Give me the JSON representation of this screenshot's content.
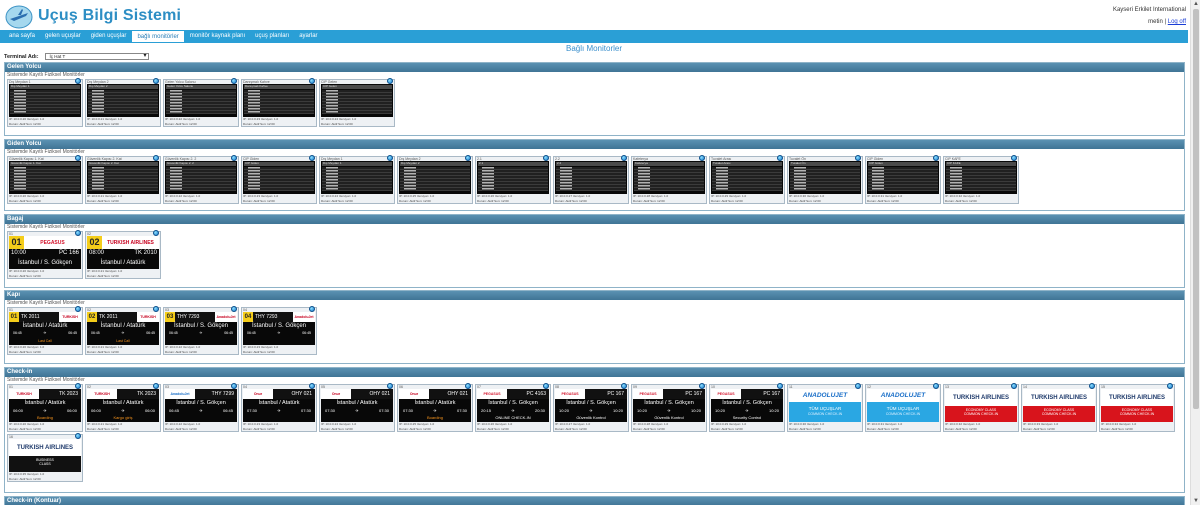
{
  "app": {
    "title": "Uçuş Bilgi Sistemi"
  },
  "user": {
    "airport": "Kayseri Erkilet International",
    "name": "metin",
    "separator": "|",
    "logout": "Log off"
  },
  "nav": [
    {
      "label": "ana sayfa",
      "active": false
    },
    {
      "label": "gelen uçuşlar",
      "active": false
    },
    {
      "label": "giden uçuşlar",
      "active": false
    },
    {
      "label": "bağlı monitörler",
      "active": true
    },
    {
      "label": "monitör kaynak planı",
      "active": false
    },
    {
      "label": "uçuş planları",
      "active": false
    },
    {
      "label": "ayarlar",
      "active": false
    }
  ],
  "page": {
    "heading": "Bağlı Monitorler",
    "terminal_label": "Terminal Adı:",
    "terminal_value": "İç Hat T"
  },
  "sections": [
    {
      "id": "gelen",
      "title": "Gelen Yolcu",
      "subtitle": "Sistemde Kayıtlı Fiziksel Monitörler",
      "kind": "list",
      "monitors": [
        "Dış Meydan 1",
        "Dış Meydan 2",
        "Gelen Yolcu Salonu",
        "Danışmalı Kahve",
        "CIP Gelen"
      ]
    },
    {
      "id": "giden",
      "title": "Giden Yolcu",
      "subtitle": "Sistemde Kayıtlı Fiziksel Monitörler",
      "kind": "list",
      "monitors": [
        "Güvenlik Kapısı 1. Kat",
        "Güvenlik Kapısı 2. Kat",
        "Güvenlik Kapısı 2. 2",
        "CIP Giden",
        "Dış Meydan 1",
        "Dış Meydan 2",
        "2.1",
        "2.2",
        "Kafeterya",
        "Tuvalet Arası",
        "Tuvalet Ön",
        "CIP Giden",
        "CIP KAFE"
      ]
    },
    {
      "id": "bagaj",
      "title": "Bagaj",
      "subtitle": "Sistemde Kayıtlı Fiziksel Monitörler",
      "kind": "baggage",
      "monitors": [
        {
          "num": "01",
          "brand": "PEGASUS",
          "brand_color": "#d4122a",
          "time": "10:00",
          "flight": "PC 166",
          "dest": "İstanbul / S. Gökçen"
        },
        {
          "num": "02",
          "brand": "TURKISH AIRLINES",
          "brand_color": "#c7001e",
          "time": "08:00",
          "flight": "TK 2010",
          "dest": "İstanbul / Atatürk"
        }
      ]
    },
    {
      "id": "kapi",
      "title": "Kapı",
      "subtitle": "Sistemde Kayıtlı Fiziksel Monitörler",
      "kind": "gate",
      "monitors": [
        {
          "num": "01",
          "flight": "TK 2011",
          "logo": "TURKISH",
          "dest": "İstanbul / Atatürk",
          "t1": "06:45",
          "t2": "06:45",
          "status": "Last Call"
        },
        {
          "num": "02",
          "flight": "TK 2011",
          "logo": "TURKISH",
          "dest": "İstanbul / Atatürk",
          "t1": "06:45",
          "t2": "06:45",
          "status": "Last Call"
        },
        {
          "num": "03",
          "flight": "THY 7293",
          "logo": "AnadoluJet",
          "dest": "İstanbul / S. Gökçen",
          "t1": "06:45",
          "t2": "06:45",
          "status": ""
        },
        {
          "num": "04",
          "flight": "THY 7293",
          "logo": "AnadoluJet",
          "dest": "İstanbul / S. Gökçen",
          "t1": "06:45",
          "t2": "06:45",
          "status": ""
        }
      ]
    },
    {
      "id": "checkin",
      "title": "Check-in",
      "subtitle": "Sistemde Kayıtlı Fiziksel Monitörler",
      "kind": "checkin",
      "monitors": [
        {
          "type": "flight",
          "logo": "TURKISH",
          "logo_color": "#c7001e",
          "flight": "TK 2023",
          "dest": "İstanbul / Atatürk",
          "t1": "06:00",
          "t2": "06:00",
          "note": "Boarding",
          "note_color": "orange"
        },
        {
          "type": "flight",
          "logo": "TURKISH",
          "logo_color": "#c7001e",
          "flight": "TK 2023",
          "dest": "İstanbul / Atatürk",
          "t1": "06:00",
          "t2": "06:00",
          "note": "Kargo giriş",
          "note_color": "orange"
        },
        {
          "type": "flight",
          "logo": "AnadoluJet",
          "logo_color": "#1a6fc8",
          "flight": "THY 7299",
          "dest": "İstanbul / S. Gökçen",
          "t1": "06:45",
          "t2": "06:45",
          "note": "",
          "note_color": "white"
        },
        {
          "type": "flight",
          "logo": "Onur",
          "logo_color": "#c7001e",
          "flight": "OHY 021",
          "dest": "İstanbul / Atatürk",
          "t1": "07:30",
          "t2": "07:30",
          "note": "",
          "note_color": "white"
        },
        {
          "type": "flight",
          "logo": "Onur",
          "logo_color": "#c7001e",
          "flight": "OHY 021",
          "dest": "İstanbul / Atatürk",
          "t1": "07:30",
          "t2": "07:30",
          "note": "",
          "note_color": "white"
        },
        {
          "type": "flight",
          "logo": "Onur",
          "logo_color": "#c7001e",
          "flight": "OHY 021",
          "dest": "İstanbul / Atatürk",
          "t1": "07:30",
          "t2": "07:30",
          "note": "Boarding",
          "note_color": "orange"
        },
        {
          "type": "flight",
          "logo": "PEGASUS",
          "logo_color": "#d4122a",
          "flight": "PC 4163",
          "dest": "İstanbul / S. Gökçen",
          "t1": "20:15",
          "t2": "20:30",
          "note": "ONLINE CHECK-IN",
          "note_color": "white"
        },
        {
          "type": "flight",
          "logo": "PEGASUS",
          "logo_color": "#d4122a",
          "flight": "PC 167",
          "dest": "İstanbul / S. Gökçen",
          "t1": "10:20",
          "t2": "10:20",
          "note": "Güvenlik Kontrol",
          "note_color": "white"
        },
        {
          "type": "flight",
          "logo": "PEGASUS",
          "logo_color": "#d4122a",
          "flight": "PC 167",
          "dest": "İstanbul / S. Gökçen",
          "t1": "10:20",
          "t2": "10:20",
          "note": "Güvenlik Kontrol",
          "note_color": "white"
        },
        {
          "type": "flight",
          "logo": "PEGASUS",
          "logo_color": "#d4122a",
          "flight": "PC 167",
          "dest": "İstanbul / S. Gökçen",
          "t1": "10:20",
          "t2": "10:20",
          "note": "Security Control",
          "note_color": "white"
        },
        {
          "type": "anadolu",
          "brand": "ANADOLUJET",
          "line1": "TÜM UÇUŞLAR",
          "line2": "COMMON CHECK-IN"
        },
        {
          "type": "anadolu",
          "brand": "ANADOLUJET",
          "line1": "TÜM UÇUŞLAR",
          "line2": "COMMON CHECK-IN"
        },
        {
          "type": "thy",
          "brand": "TURKISH AIRLINES",
          "line1": "ECONOMY CLASS",
          "line2": "COMMON CHECK-IN"
        },
        {
          "type": "thy",
          "brand": "TURKISH AIRLINES",
          "line1": "ECONOMY CLASS",
          "line2": "COMMON CHECK-IN"
        },
        {
          "type": "thy",
          "brand": "TURKISH AIRLINES",
          "line1": "ECONOMY CLASS",
          "line2": "COMMON CHECK-IN"
        },
        {
          "type": "thy-biz",
          "brand": "TURKISH AIRLINES",
          "line1": "BUSINESS",
          "line2": "CLASS"
        }
      ]
    },
    {
      "id": "checkin-kontuar",
      "title": "Check-in (Kontuar)",
      "subtitle": "",
      "kind": "none",
      "monitors": []
    }
  ]
}
